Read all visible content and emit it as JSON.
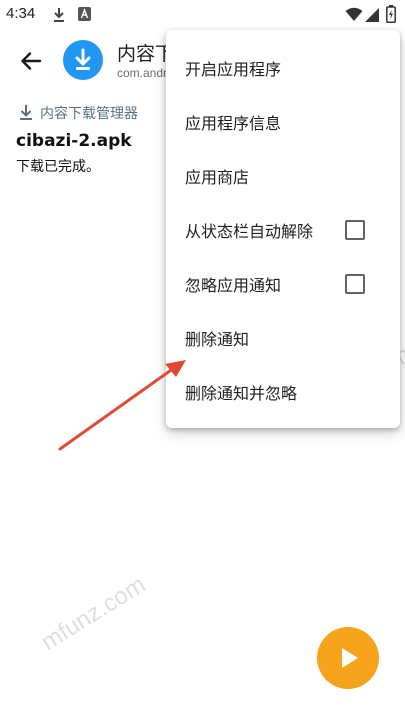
{
  "status_bar": {
    "time": "4:34"
  },
  "app_bar": {
    "title": "内容下载管理器",
    "package": "com.android.providers.downloads"
  },
  "notification": {
    "channel": "内容下载管理器",
    "title": "cibazi-2.apk",
    "text": "下载已完成。"
  },
  "menu": {
    "items": [
      {
        "label": "开启应用程序"
      },
      {
        "label": "应用程序信息"
      },
      {
        "label": "应用商店"
      },
      {
        "label": "从状态栏自动解除",
        "checked": false
      },
      {
        "label": "忽略应用通知",
        "checked": false
      },
      {
        "label": "删除通知"
      },
      {
        "label": "删除通知并忽略"
      }
    ]
  },
  "watermark": {
    "text": "mfunz.com"
  },
  "colors": {
    "accent": "#2196f3",
    "arrow": "#e04a35",
    "fab": "#f5a31a"
  }
}
